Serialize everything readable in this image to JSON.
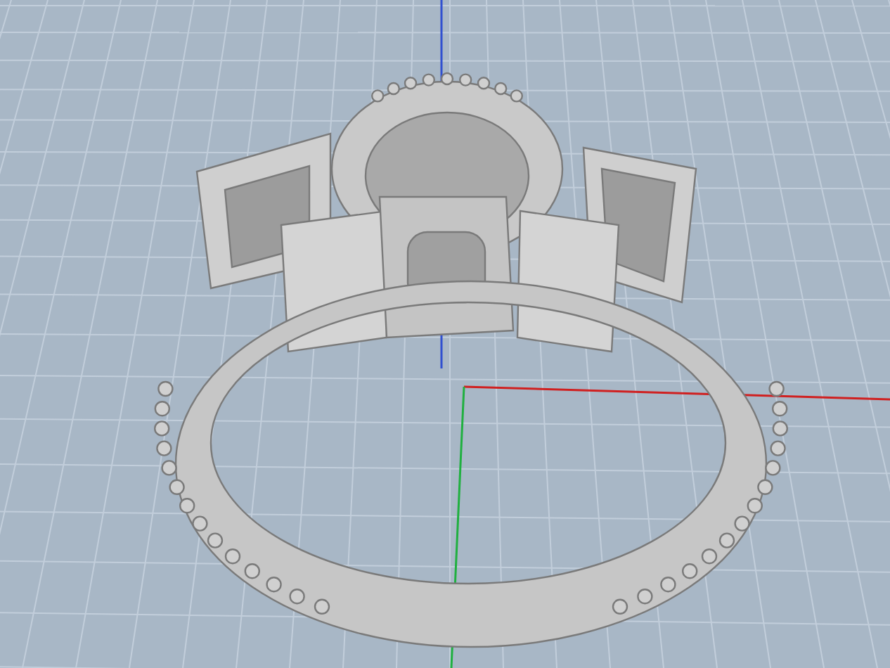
{
  "viewport": {
    "grid": true,
    "axes": true,
    "kind": "ring"
  }
}
